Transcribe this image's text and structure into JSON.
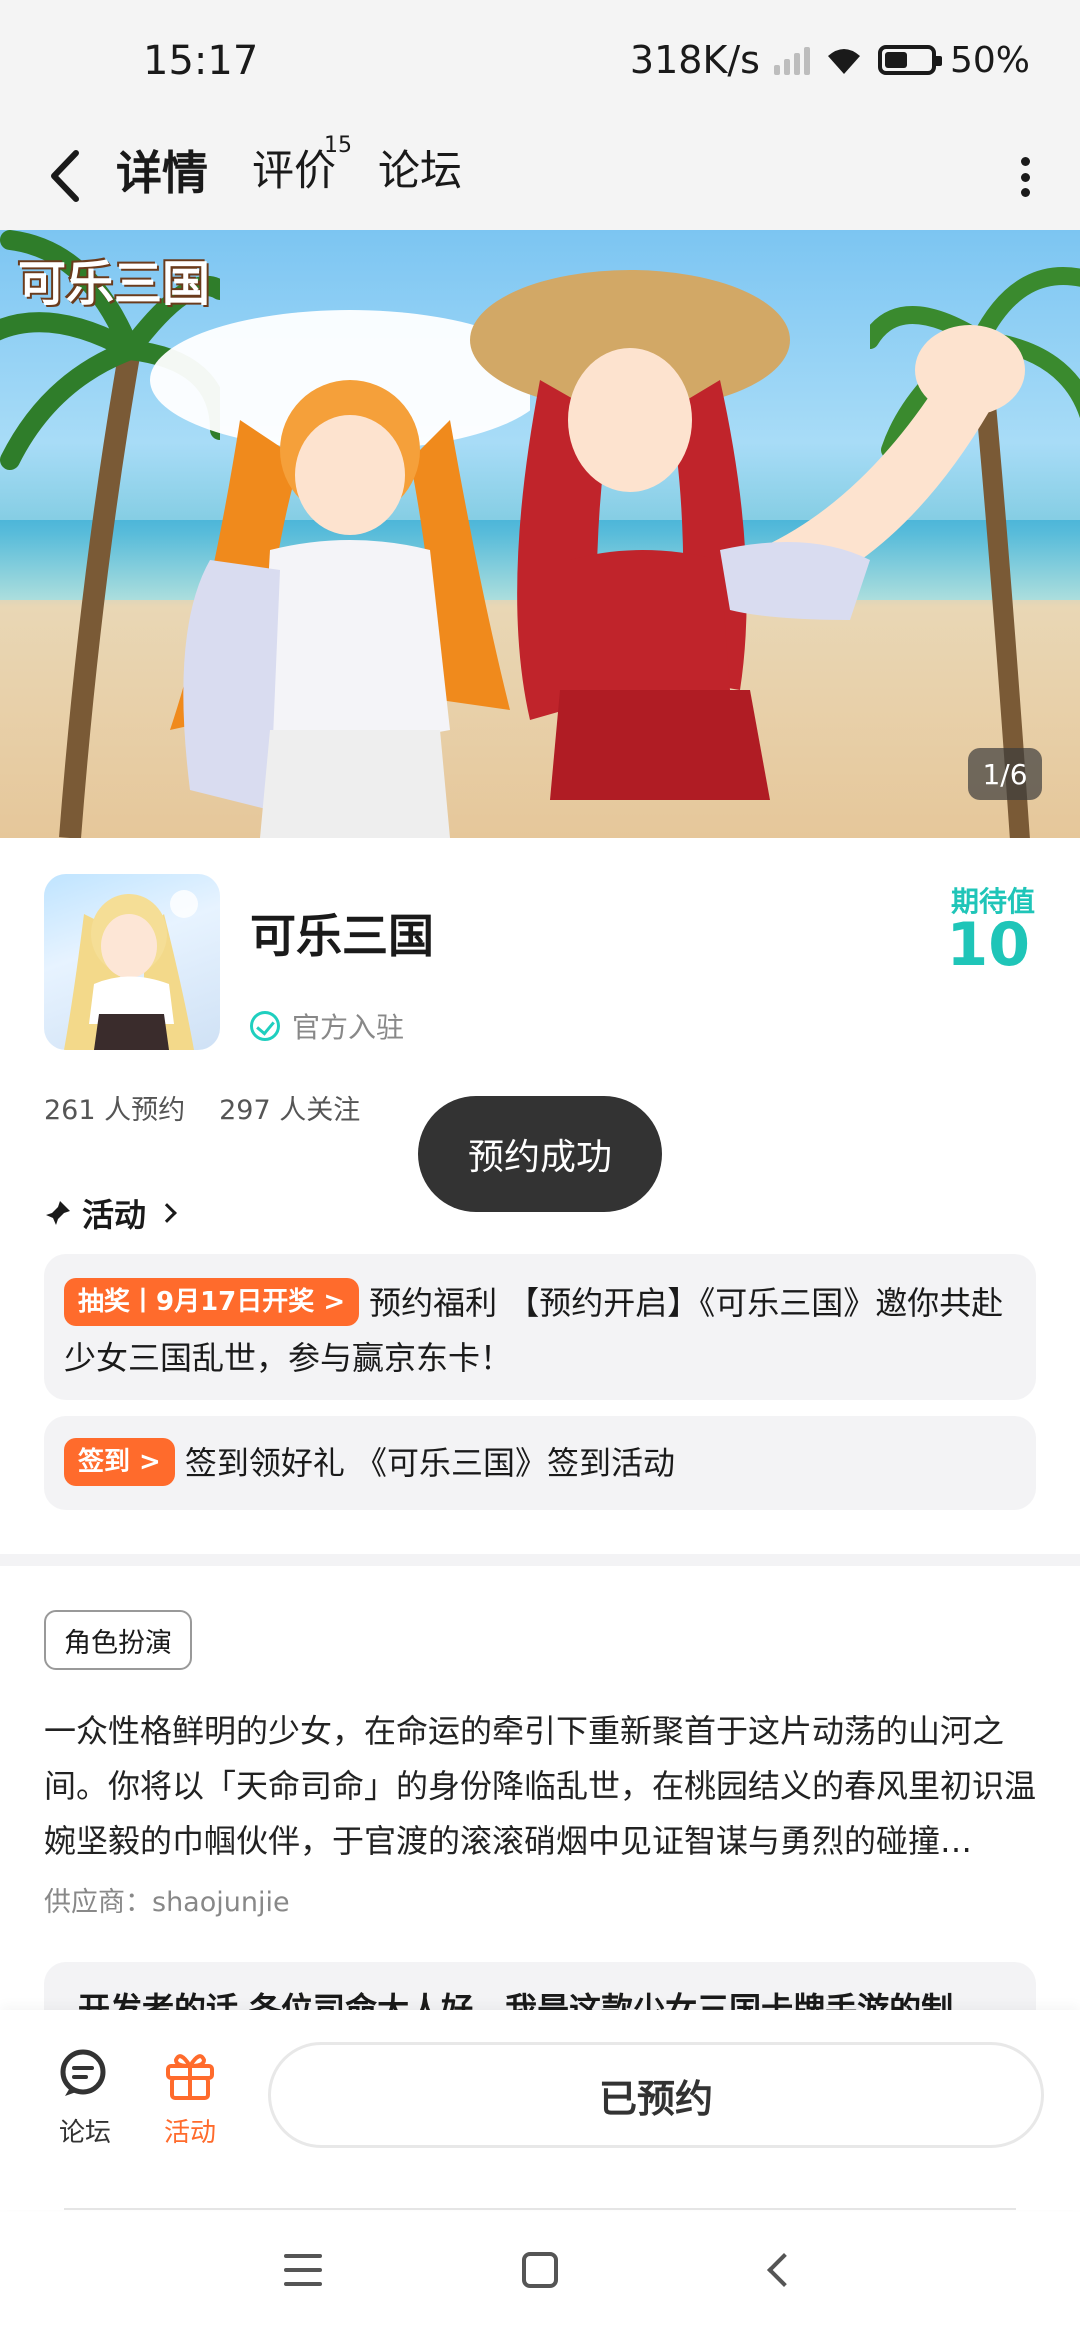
{
  "status_bar": {
    "time": "15:17",
    "net_speed": "318K/s",
    "battery": "50%",
    "battery_level": 0.5
  },
  "nav": {
    "tabs": [
      {
        "label": "详情",
        "active": true
      },
      {
        "label": "评价",
        "badge": "15"
      },
      {
        "label": "论坛"
      }
    ]
  },
  "banner": {
    "logo_text": "可乐三国",
    "counter": "1/6"
  },
  "game": {
    "title": "可乐三国",
    "official_label": "官方入驻",
    "expect_label": "期待值",
    "expect_value": "10",
    "reservations": "261 人预约",
    "followers": "297 人关注"
  },
  "toast": "预约成功",
  "activity": {
    "heading": "活动",
    "items": [
      {
        "tag": "抽奖丨9月17日开奖 >",
        "text": "预约福利 【预约开启】《可乐三国》邀你共赴少女三国乱世，参与赢京东卡！"
      },
      {
        "tag": "签到 >",
        "text": "签到领好礼 《可乐三国》签到活动"
      }
    ]
  },
  "details": {
    "genre_tag": "角色扮演",
    "description": "一众性格鲜明的少女，在命运的牵引下重新聚首于这片动荡的山河之间。你将以「天命司命」的身份降临乱世，在桃园结义的春风里初识温婉坚毅的巾帼伙伴，于官渡的滚滚硝烟中见证智谋与勇烈的碰撞…",
    "provider": "供应商：shaojunjie",
    "dev_note": "开发者的话 各位司命大人好，我是这款少女三国卡牌手游的制"
  },
  "bottom_bar": {
    "forum_label": "论坛",
    "activity_label": "活动",
    "reserved_label": "已预约"
  },
  "colors": {
    "accent": "#1fcfbf",
    "orange": "#ff6b2c",
    "toast_bg": "#333333"
  },
  "icons": [
    "back-arrow-icon",
    "more-vertical-icon",
    "verified-check-icon",
    "pin-icon",
    "chevron-right-icon",
    "forum-chat-icon",
    "gift-icon",
    "menu-icon",
    "home-icon",
    "back-icon"
  ]
}
